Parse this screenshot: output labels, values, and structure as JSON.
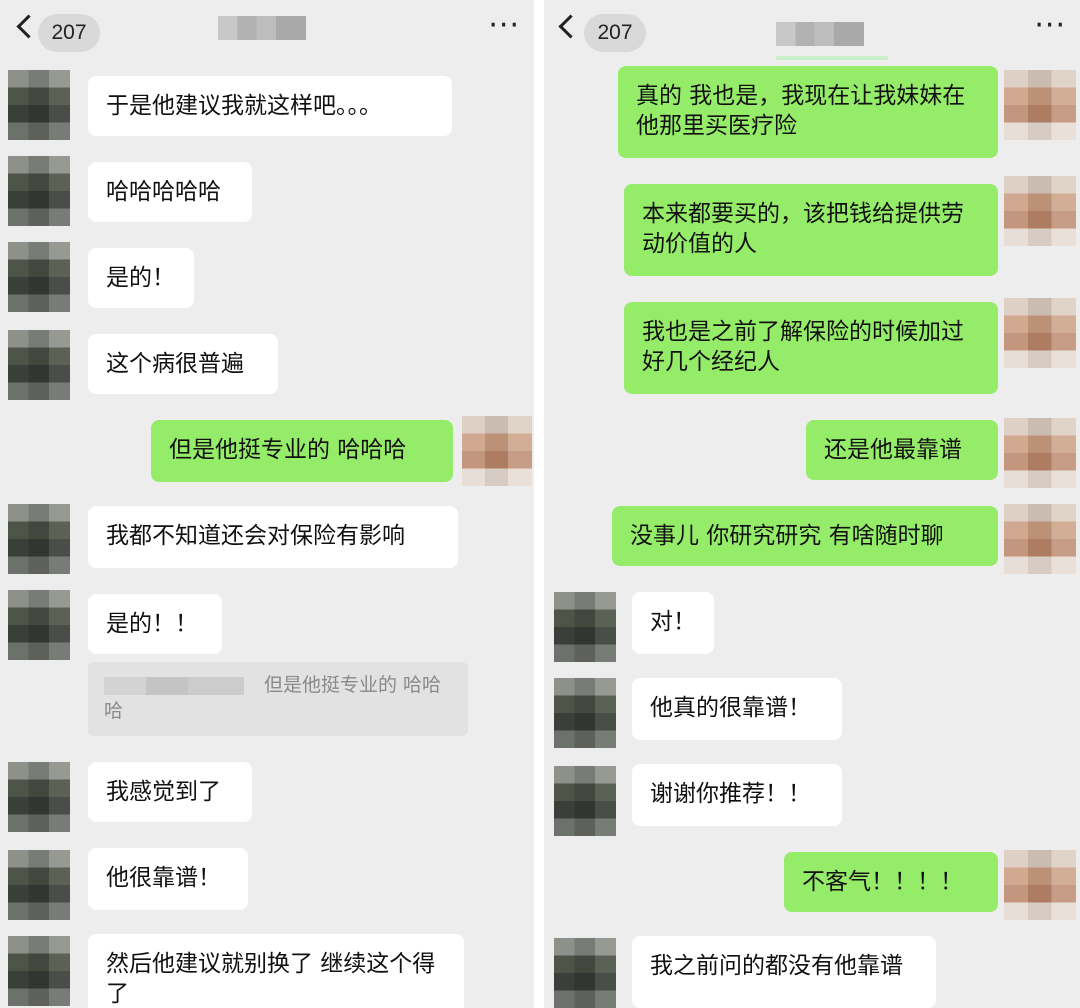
{
  "left": {
    "header": {
      "badge": "207",
      "more": "···"
    },
    "messages": [
      {
        "text": "于是他建议我就这样吧。。。"
      },
      {
        "text": "哈哈哈哈哈"
      },
      {
        "text": "是的！"
      },
      {
        "text": "这个病很普遍"
      },
      {
        "text": "但是他挺专业的 哈哈哈"
      },
      {
        "text": "我都不知道还会对保险有影响"
      },
      {
        "text": "是的！！"
      },
      {
        "text": "我感觉到了"
      },
      {
        "text": "他很靠谱！"
      },
      {
        "text": "然后他建议就别换了 继续这个得了"
      }
    ],
    "quote": {
      "text": "但是他挺专业的 哈哈哈"
    }
  },
  "right": {
    "header": {
      "badge": "207",
      "more": "···"
    },
    "messages": [
      {
        "text": "真的 我也是，我现在让我妹妹在他那里买医疗险"
      },
      {
        "text": "本来都要买的，该把钱给提供劳动价值的人"
      },
      {
        "text": "我也是之前了解保险的时候加过好几个经纪人"
      },
      {
        "text": "还是他最靠谱"
      },
      {
        "text": "没事儿 你研究研究 有啥随时聊"
      },
      {
        "text": "对！"
      },
      {
        "text": "他真的很靠谱！"
      },
      {
        "text": "谢谢你推荐！！"
      },
      {
        "text": "不客气！！！！"
      },
      {
        "text": "我之前问的都没有他靠谱"
      }
    ]
  }
}
